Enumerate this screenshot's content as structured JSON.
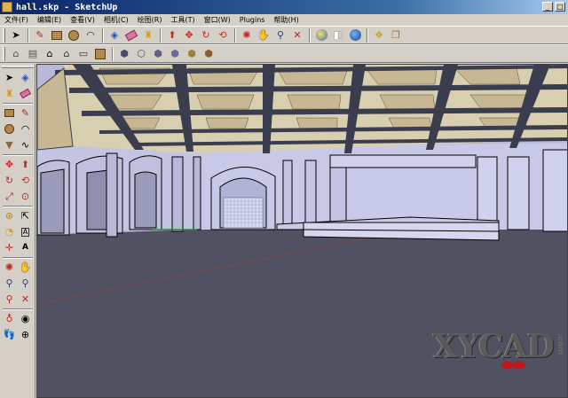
{
  "window": {
    "title": "hall.skp - SketchUp"
  },
  "menu": [
    "文件(F)",
    "编辑(E)",
    "查看(V)",
    "相机(C)",
    "绘图(R)",
    "工具(T)",
    "窗口(W)",
    "Plugins",
    "帮助(H)"
  ],
  "watermark": {
    "text": "XYCAD",
    "suffix": ".com"
  },
  "icons": {
    "toolbar1": [
      "select-icon",
      "pencil-icon",
      "rectangle-icon",
      "circle-icon",
      "arc-icon",
      "make-component-icon",
      "eraser-icon",
      "paint-bucket-icon",
      "push-pull-icon",
      "move-icon",
      "rotate-icon",
      "follow-me-icon",
      "orbit-icon",
      "pan-icon",
      "zoom-icon",
      "zoom-extents-icon",
      "get-models-icon",
      "share-model-icon",
      "google-earth-icon",
      "components-icon",
      "materials-icon"
    ],
    "toolbar2": [
      "iso-view-icon",
      "top-view-icon",
      "front-view-icon",
      "right-view-icon",
      "back-view-icon",
      "left-view-icon",
      "xray-icon",
      "wireframe-icon",
      "hidden-line-icon",
      "shaded-icon",
      "shaded-texture-icon",
      "monochrome-icon"
    ],
    "left": [
      "select-icon",
      "make-component-icon",
      "paint-bucket-icon",
      "eraser-icon",
      "rectangle-icon",
      "line-icon",
      "circle-icon",
      "arc-icon",
      "polygon-icon",
      "freehand-icon",
      "move-icon",
      "push-pull-icon",
      "rotate-icon",
      "follow-me-icon",
      "scale-icon",
      "offset-icon",
      "tape-measure-icon",
      "dimension-icon",
      "protractor-icon",
      "text-icon",
      "axes-icon",
      "3d-text-icon",
      "orbit-icon",
      "pan-icon",
      "zoom-icon",
      "zoom-window-icon",
      "previous-view-icon",
      "zoom-extents-icon",
      "position-camera-icon",
      "look-around-icon",
      "walk-icon",
      "section-plane-icon"
    ]
  },
  "colors": {
    "sky": "#b7b9d6",
    "floor": "#505262",
    "ceiling": "#d8ceb0",
    "beam": "#3a3d4e",
    "wall": "#c8c9e6"
  }
}
